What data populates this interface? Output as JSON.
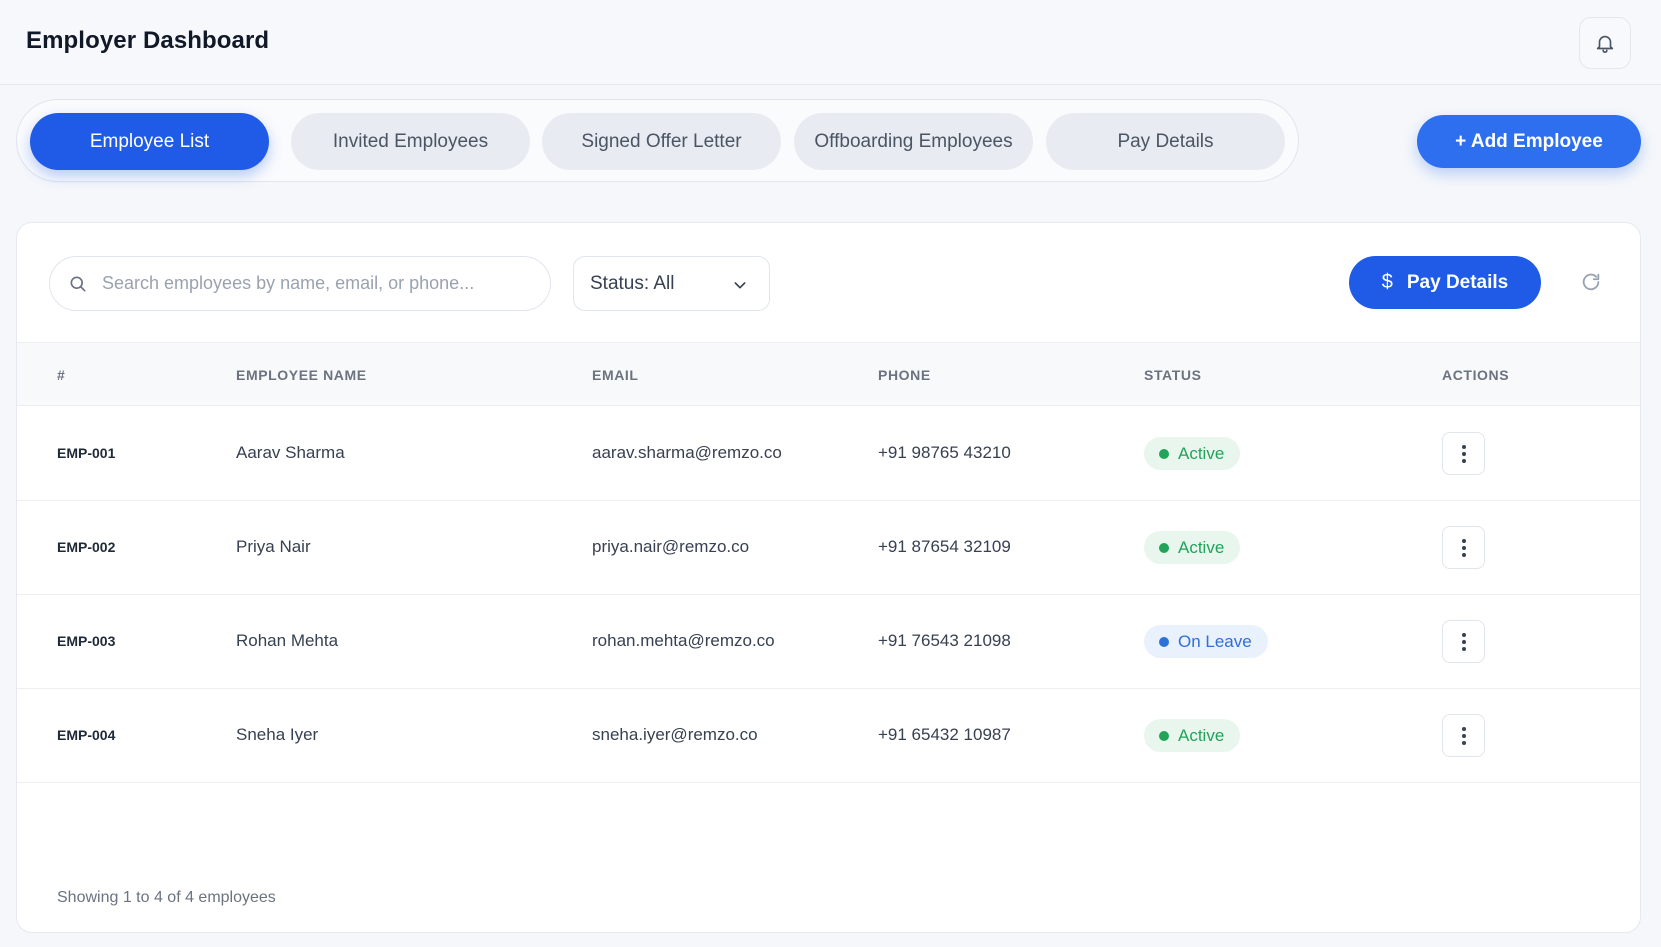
{
  "header": {
    "title": "Employer Dashboard",
    "bell_icon": "bell-icon"
  },
  "tabs": [
    {
      "label": "Employee List",
      "active": true
    },
    {
      "label": "Invited Employees",
      "active": false
    },
    {
      "label": "Signed Offer Letter",
      "active": false
    },
    {
      "label": "Offboarding Employees",
      "active": false
    },
    {
      "label": "Pay Details",
      "active": false
    }
  ],
  "add_button": {
    "label": "+ Add Employee"
  },
  "toolbar": {
    "search_placeholder": "Search employees by name, email, or phone...",
    "search_value": "",
    "status_filter": "Status: All",
    "pay_button": "Pay Details",
    "pay_icon_glyph": "$"
  },
  "table": {
    "columns": [
      "#",
      "EMPLOYEE NAME",
      "EMAIL",
      "PHONE",
      "STATUS",
      "ACTIONS"
    ],
    "rows": [
      {
        "id": "EMP-001",
        "name": "Aarav Sharma",
        "email": "aarav.sharma@remzo.co",
        "phone": "+91 98765 43210",
        "status": "Active",
        "status_type": "active"
      },
      {
        "id": "EMP-002",
        "name": "Priya Nair",
        "email": "priya.nair@remzo.co",
        "phone": "+91 87654 32109",
        "status": "Active",
        "status_type": "active"
      },
      {
        "id": "EMP-003",
        "name": "Rohan Mehta",
        "email": "rohan.mehta@remzo.co",
        "phone": "+91 76543 21098",
        "status": "On Leave",
        "status_type": "leave"
      },
      {
        "id": "EMP-004",
        "name": "Sneha Iyer",
        "email": "sneha.iyer@remzo.co",
        "phone": "+91 65432 10987",
        "status": "Active",
        "status_type": "active"
      }
    ]
  },
  "footer": {
    "summary": "Showing 1 to 4 of 4 employees"
  },
  "colors": {
    "primary": "#1f5be6",
    "accent": "#2e6ff0",
    "active_status": "#22a35a",
    "leave_status": "#2f6fd8"
  }
}
